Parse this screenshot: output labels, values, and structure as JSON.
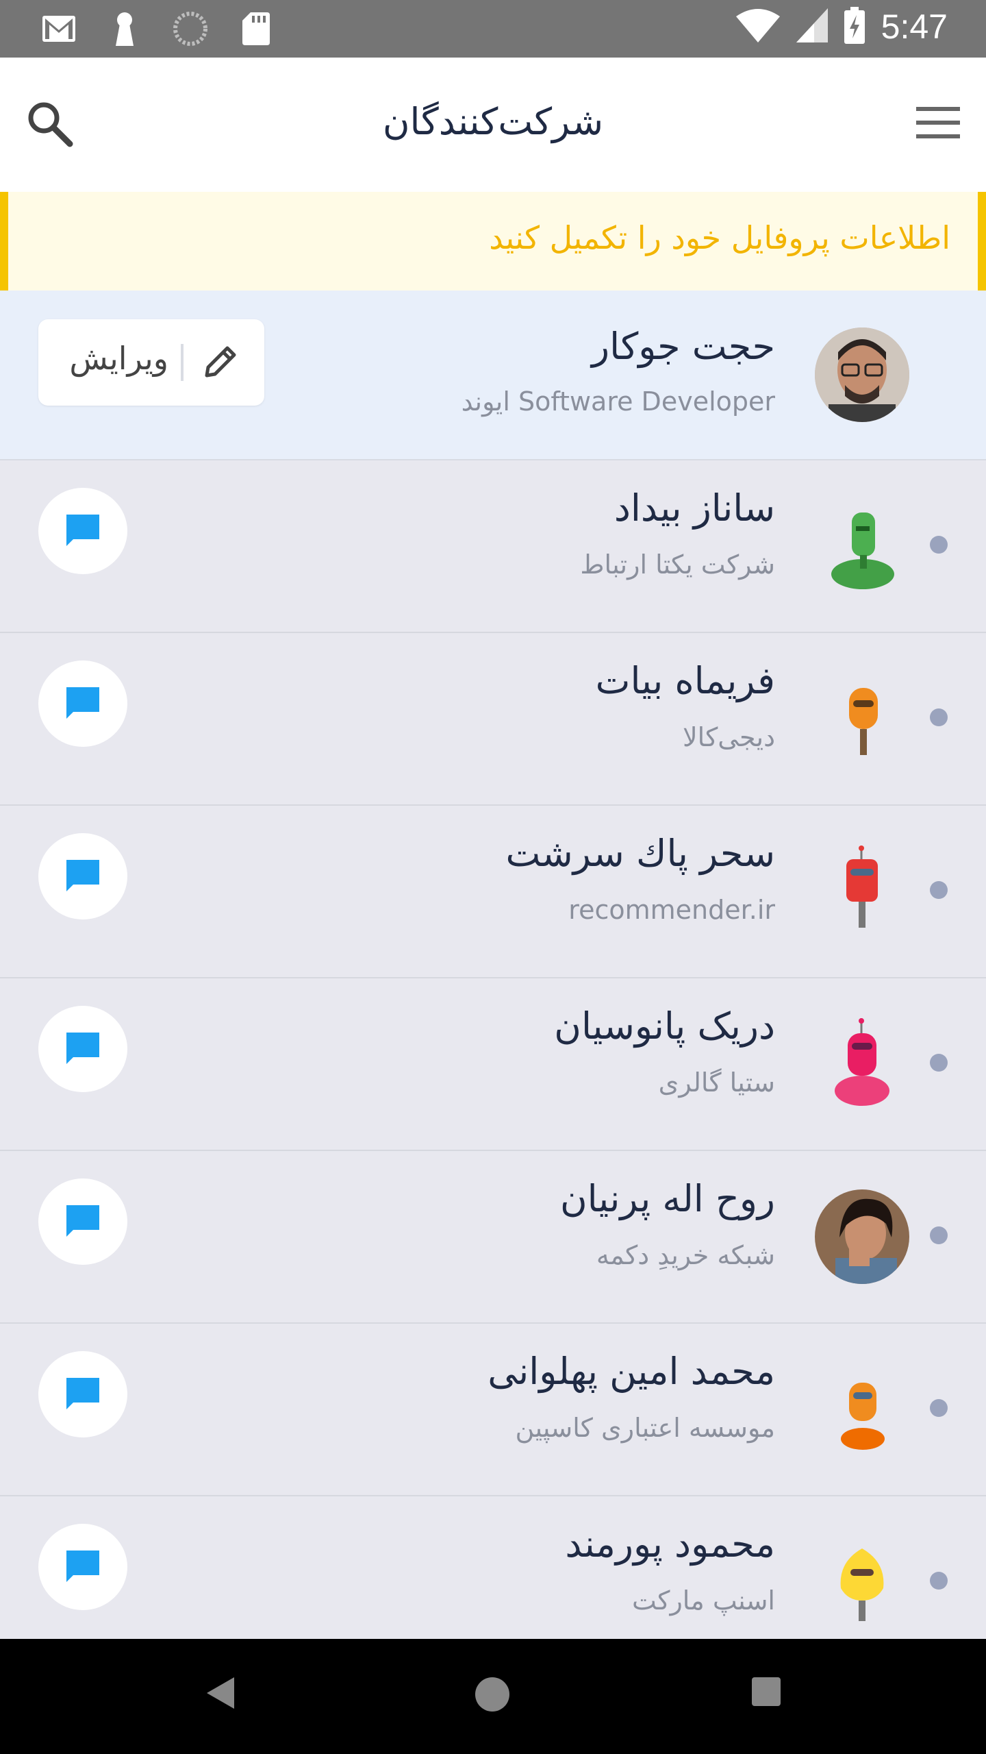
{
  "status_bar": {
    "time": "5:47",
    "icons": [
      "gmail-icon",
      "keyhole-icon",
      "loading-icon",
      "sd-card-icon",
      "wifi-icon",
      "signal-icon",
      "battery-charging-icon"
    ]
  },
  "app_bar": {
    "title": "شرکت‌کنندگان",
    "search_icon": "search-icon",
    "menu_icon": "menu-icon"
  },
  "banner": {
    "text": "اطلاعات پروفایل خود را تکمیل کنید",
    "accent_color": "#f5c400"
  },
  "me": {
    "name": "حجت جوکار",
    "subtitle": "Software Developer ایوند",
    "edit_label": "ویرایش"
  },
  "participants": [
    {
      "name": "ساناز بیداد",
      "company": "شرکت یکتا ارتباط",
      "avatar": "robot-green"
    },
    {
      "name": "فریماه بیات",
      "company": "دیجی‌کالا",
      "avatar": "robot-orange"
    },
    {
      "name": "سحر  پاك سرشت",
      "company": "recommender.ir",
      "avatar": "robot-red"
    },
    {
      "name": "دریک پانوسیان",
      "company": "ستیا گالری",
      "avatar": "robot-pink"
    },
    {
      "name": "روح اله پرنیان",
      "company": "شبکه خریدِ دکمه",
      "avatar": "photo"
    },
    {
      "name": "محمد امین پهلوانی",
      "company": "موسسه اعتباری کاسپین",
      "avatar": "robot-orange-2"
    },
    {
      "name": "محمود پورمند",
      "company": "اسنپ مارکت",
      "avatar": "robot-yellow"
    }
  ],
  "colors": {
    "chat_icon": "#1da1f2",
    "list_bg": "#e8e8ef",
    "me_bg": "#e8effa",
    "title": "#1f2a44"
  }
}
